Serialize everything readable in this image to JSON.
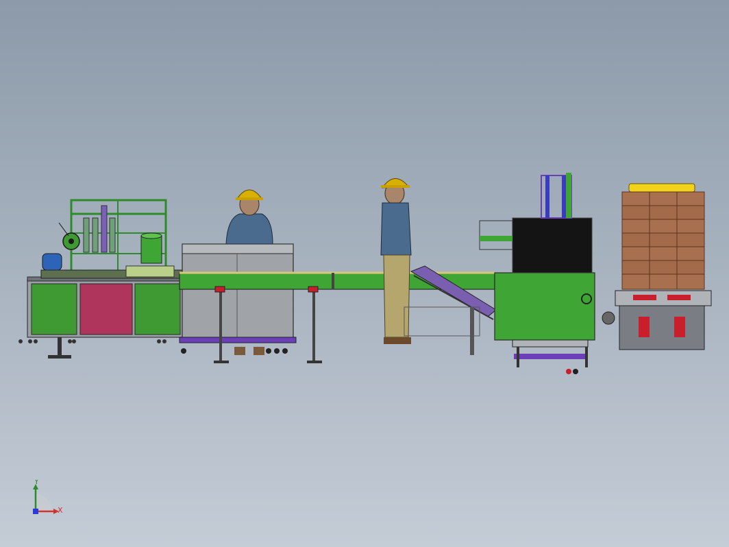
{
  "viewport": {
    "background_top": "#8c9aa9",
    "background_bottom": "#c4ccd6"
  },
  "triad": {
    "x_label": "X",
    "y_label": "Y",
    "x_color": "#d0342c",
    "y_color": "#2d8a2d",
    "z_color": "#2b3bd6"
  },
  "model": {
    "frame_green": "#3fa535",
    "panel_red": "#b0355c",
    "steel_gray": "#8f959c",
    "screen_black": "#141414",
    "carton_brown": "#a9704f",
    "helmet_yellow": "#d8b000",
    "accent_purple": "#6a3fb8"
  }
}
